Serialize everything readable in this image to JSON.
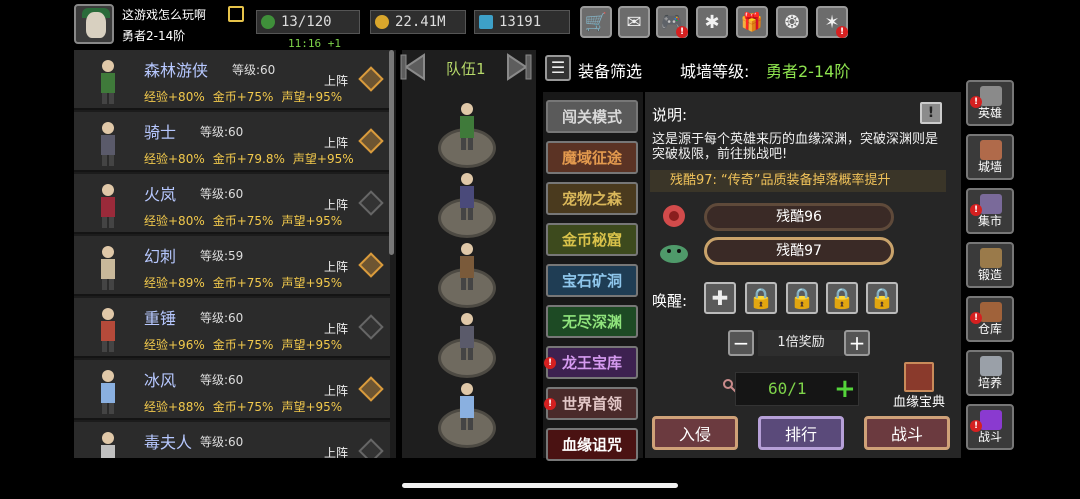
{
  "user": {
    "name": "这游戏怎么玩啊",
    "rank": "勇者2-14阶"
  },
  "resources": {
    "energy": "13/120",
    "energy_timer": "11:16 +1",
    "gold": "22.41M",
    "gems": "13191"
  },
  "top_icons": [
    {
      "name": "shop-cart-icon",
      "glyph": "🛒"
    },
    {
      "name": "mail-icon",
      "glyph": "✉"
    },
    {
      "name": "gamepad-icon",
      "glyph": "🎮"
    },
    {
      "name": "settings-gear-icon",
      "glyph": "✱"
    },
    {
      "name": "gift-icon",
      "glyph": "🎁"
    },
    {
      "name": "color-wheel-icon",
      "glyph": "❂"
    },
    {
      "name": "crack-icon",
      "glyph": "✶"
    }
  ],
  "heroes": [
    {
      "name": "森林游侠",
      "level": "等级:60",
      "exp": "经验+80%",
      "gold": "金币+75%",
      "fame": "声望+95%",
      "deploy": "上阵",
      "deployed": true
    },
    {
      "name": "骑士",
      "level": "等级:60",
      "exp": "经验+80%",
      "gold": "金币+79.8%",
      "fame": "声望+95%",
      "deploy": "上阵",
      "deployed": true
    },
    {
      "name": "火岚",
      "level": "等级:60",
      "exp": "经验+80%",
      "gold": "金币+75%",
      "fame": "声望+95%",
      "deploy": "上阵",
      "deployed": false
    },
    {
      "name": "幻刺",
      "level": "等级:59",
      "exp": "经验+89%",
      "gold": "金币+75%",
      "fame": "声望+95%",
      "deploy": "上阵",
      "deployed": true
    },
    {
      "name": "重锤",
      "level": "等级:60",
      "exp": "经验+96%",
      "gold": "金币+75%",
      "fame": "声望+95%",
      "deploy": "上阵",
      "deployed": false
    },
    {
      "name": "冰风",
      "level": "等级:60",
      "exp": "经验+88%",
      "gold": "金币+75%",
      "fame": "声望+95%",
      "deploy": "上阵",
      "deployed": true
    },
    {
      "name": "毒夫人",
      "level": "等级:60",
      "exp": "",
      "gold": "",
      "fame": "",
      "deploy": "上阵",
      "deployed": false
    }
  ],
  "team": {
    "label": "队伍1"
  },
  "header": {
    "filter_label": "装备筛选",
    "wall_label": "城墙等级:",
    "wall_value": "勇者2-14阶"
  },
  "modes": [
    {
      "label": "闯关模式",
      "bg": "#5a5a5a",
      "fg": "#d9d9d9"
    },
    {
      "label": "魔域征途",
      "bg": "#5b3324",
      "fg": "#e39a4e"
    },
    {
      "label": "宠物之森",
      "bg": "#4a3a1e",
      "fg": "#d9b75a"
    },
    {
      "label": "金币秘窟",
      "bg": "#3d4a1d",
      "fg": "#d9c24a"
    },
    {
      "label": "宝石矿洞",
      "bg": "#1f3d54",
      "fg": "#8fc7ec"
    },
    {
      "label": "无尽深渊",
      "bg": "#1d4a24",
      "fg": "#8fe37c"
    },
    {
      "label": "龙王宝库",
      "bg": "#3d2150",
      "fg": "#d59aef"
    },
    {
      "label": "世界首领",
      "bg": "#4a2a2a",
      "fg": "#e3c7c7"
    },
    {
      "label": "血缘诅咒",
      "bg": "#4a1212",
      "fg": "#ffffff"
    }
  ],
  "description": {
    "title": "说明:",
    "text": "这是源于每个英雄来历的血缘深渊，突破深渊则是突破极限，前往挑战吧!",
    "notice": "残酷97: “传奇”品质装备掉落概率提升"
  },
  "levels": [
    {
      "label": "残酷96"
    },
    {
      "label": "残酷97"
    }
  ],
  "awaken": {
    "label": "唤醒:"
  },
  "multiplier": {
    "label": "1倍奖励"
  },
  "attempts": {
    "count": "60/1"
  },
  "codex": {
    "label": "血缘宝典"
  },
  "actions": {
    "invade": "入侵",
    "rank": "排行",
    "battle": "战斗"
  },
  "sidebar": [
    {
      "label": "英雄",
      "icon": "helmet-icon",
      "color": "#8a8a8a",
      "badge": true
    },
    {
      "label": "城墙",
      "icon": "wall-icon",
      "color": "#b06a4a",
      "badge": false
    },
    {
      "label": "集市",
      "icon": "market-icon",
      "color": "#7a6a9a",
      "badge": true
    },
    {
      "label": "锻造",
      "icon": "anvil-icon",
      "color": "#9a7a4a",
      "badge": false
    },
    {
      "label": "仓库",
      "icon": "warehouse-icon",
      "color": "#a0623a",
      "badge": true
    },
    {
      "label": "培养",
      "icon": "chalice-icon",
      "color": "#9aa0a8",
      "badge": false
    },
    {
      "label": "战斗",
      "icon": "portal-icon",
      "color": "#8a3ad0",
      "badge": true
    }
  ],
  "colors": {
    "accent_green": "#8ee34f",
    "gold_text": "#f2c94c",
    "hero_name": "#b7c8ff"
  }
}
